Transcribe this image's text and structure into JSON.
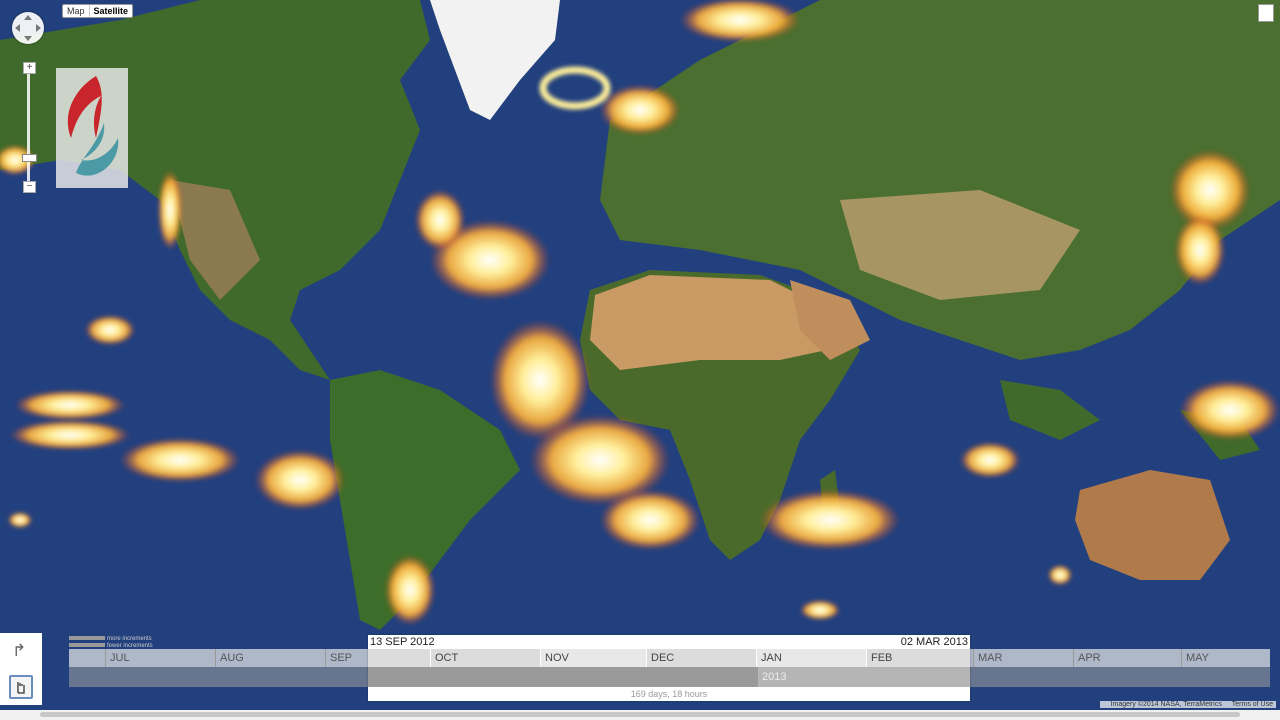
{
  "map": {
    "type_options": [
      "Map",
      "Satellite"
    ],
    "active_type": "Satellite",
    "heat_colors": [
      "#ffffff",
      "#ffef9a",
      "#ffb23a",
      "#e8421c",
      "#9b1010"
    ],
    "ocean_color": "#22407e",
    "land_color": "#3f6a2c",
    "desert_color": "#c99a63",
    "ice_color": "#f2f2f2"
  },
  "controls": {
    "pan_icon": "pan-control-icon",
    "zoom_in": "+",
    "zoom_out": "−",
    "share_icon": "share-arrow-icon",
    "hand_icon": "hand-cursor-icon"
  },
  "timeline": {
    "increments_more": "more increments",
    "increments_fewer": "fewer increments",
    "months": [
      "JUL",
      "AUG",
      "SEP",
      "OCT",
      "NOV",
      "DEC",
      "JAN",
      "FEB",
      "MAR",
      "APR",
      "MAY"
    ],
    "year_label": "2013",
    "selection": {
      "start": "13 SEP 2012",
      "end": "02 MAR 2013",
      "duration": "169 days, 18 hours"
    }
  },
  "attribution": {
    "imagery": "Imagery ©2014 NASA, TerraMetrics",
    "terms": "Terms of Use"
  }
}
